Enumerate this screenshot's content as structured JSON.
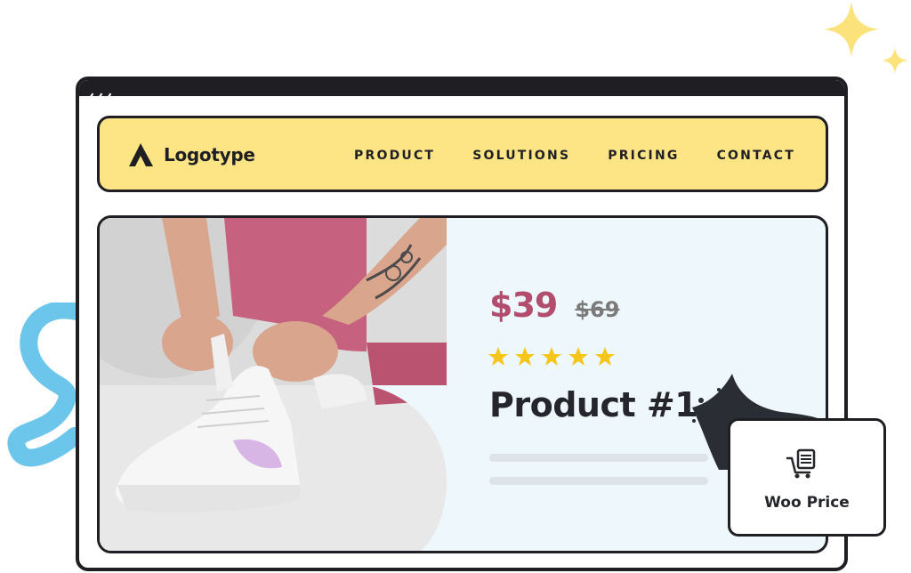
{
  "logo": {
    "text": "Logotype"
  },
  "nav": {
    "links": [
      {
        "label": "PRODUCT"
      },
      {
        "label": "SOLUTIONS"
      },
      {
        "label": "PRICING"
      },
      {
        "label": "CONTACT"
      }
    ]
  },
  "product": {
    "price": "$39",
    "old_price": "$69",
    "rating": 5,
    "rating_max": 5,
    "title": "Product #1"
  },
  "widget": {
    "label": "Woo Price",
    "icon": "cart-list-icon"
  },
  "colors": {
    "nav_bg": "#fde585",
    "price": "#b34d6d",
    "star": "#f5c518",
    "card_bg": "#eef7fb",
    "accent_blue": "#6cc6ec",
    "sparkle": "#fbe27a"
  }
}
